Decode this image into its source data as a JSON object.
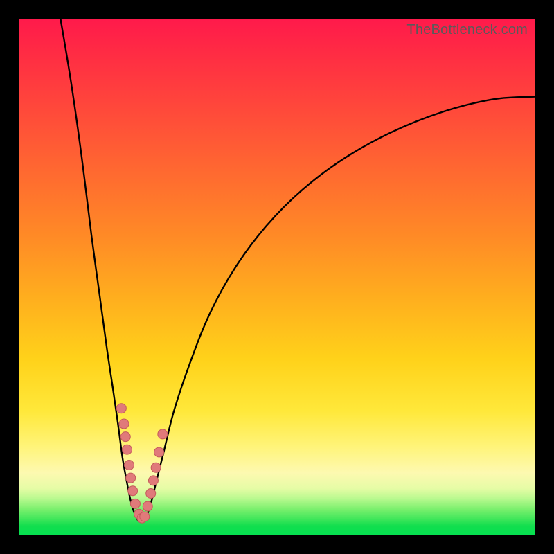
{
  "watermark": "TheBottleneck.com",
  "colors": {
    "gradient_top": "#ff1a4b",
    "gradient_mid": "#ffd21a",
    "gradient_bottom": "#06e050",
    "curve": "#000000",
    "dot": "#e07a7a",
    "dot_stroke": "#c45b5b"
  },
  "chart_data": {
    "type": "line",
    "title": "",
    "xlabel": "",
    "ylabel": "",
    "xlim": [
      0,
      100
    ],
    "ylim": [
      0,
      100
    ],
    "grid": false,
    "legend": false,
    "note": "Values are read as percentages of the plot area (x: left→right, y: bottom→top). The green floor sits near y≈2–5. Dots mark points on both branches near the valley.",
    "series": [
      {
        "name": "left_branch",
        "x": [
          8.0,
          10.0,
          12.0,
          14.0,
          15.5,
          17.0,
          18.2,
          19.2,
          20.0,
          20.8,
          21.5,
          22.2,
          23.0
        ],
        "y": [
          100.0,
          88.0,
          74.0,
          58.0,
          47.0,
          36.0,
          28.0,
          21.0,
          15.0,
          10.5,
          7.0,
          4.5,
          2.8
        ]
      },
      {
        "name": "right_branch",
        "x": [
          24.5,
          25.5,
          26.5,
          28.0,
          30.0,
          33.0,
          37.0,
          42.0,
          48.0,
          55.0,
          63.0,
          72.0,
          82.0,
          92.0,
          100.0
        ],
        "y": [
          3.0,
          6.0,
          10.0,
          16.0,
          24.0,
          33.0,
          43.0,
          52.0,
          60.0,
          67.0,
          73.0,
          78.0,
          82.0,
          84.5,
          85.0
        ]
      },
      {
        "name": "valley_floor",
        "x": [
          23.0,
          23.8,
          24.5
        ],
        "y": [
          2.8,
          2.5,
          3.0
        ]
      }
    ],
    "dots": {
      "left": {
        "x": [
          19.8,
          20.3,
          20.6,
          20.9,
          21.3,
          21.6,
          22.0,
          22.5,
          23.2,
          23.8
        ],
        "y": [
          24.5,
          21.5,
          19.0,
          16.5,
          13.5,
          11.0,
          8.5,
          6.0,
          4.0,
          3.2
        ]
      },
      "right": {
        "x": [
          24.3,
          24.9,
          25.5,
          26.0,
          26.5,
          27.1,
          27.8
        ],
        "y": [
          3.5,
          5.5,
          8.0,
          10.5,
          13.0,
          16.0,
          19.5
        ]
      }
    }
  }
}
